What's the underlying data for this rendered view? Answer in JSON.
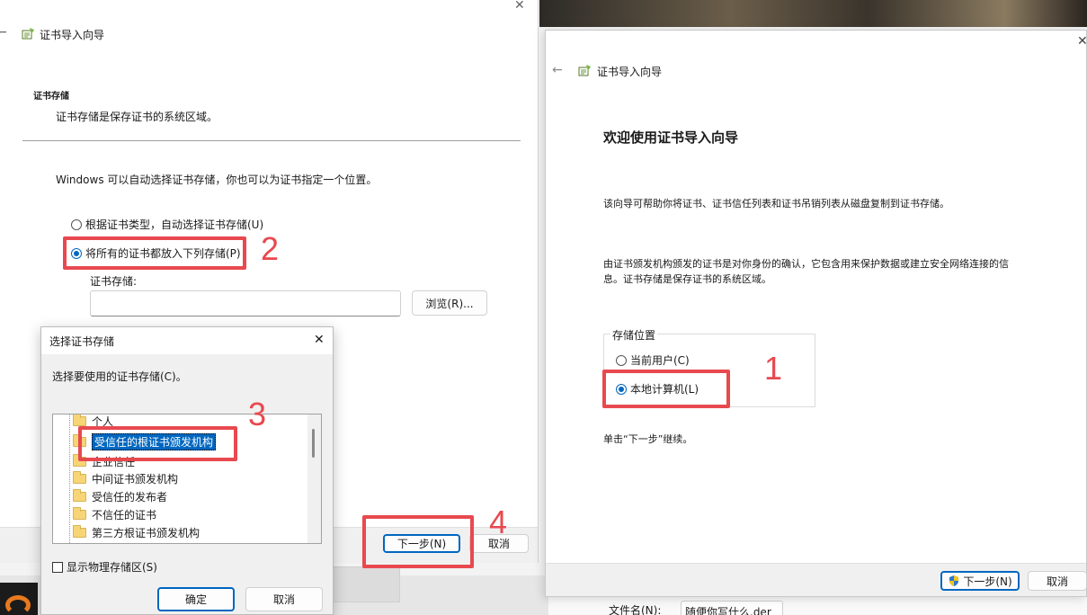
{
  "left_wizard": {
    "title": "证书导入向导",
    "section_title": "证书存储",
    "section_desc": "证书存储是保存证书的系统区域。",
    "intro": "Windows 可以自动选择证书存储，你也可以为证书指定一个位置。",
    "option_auto": "根据证书类型，自动选择证书存储(U)",
    "option_manual": "将所有的证书都放入下列存储(P)",
    "store_label": "证书存储:",
    "store_value": "",
    "browse_label": "浏览(R)...",
    "next_label": "下一步(N)",
    "cancel_label": "取消",
    "close_glyph": "✕",
    "back_glyph": "←"
  },
  "store_dialog": {
    "title": "选择证书存储",
    "instruction": "选择要使用的证书存储(C)。",
    "items": [
      {
        "label": "个人",
        "selected": false
      },
      {
        "label": "受信任的根证书颁发机构",
        "selected": true
      },
      {
        "label": "企业信任",
        "selected": false
      },
      {
        "label": "中间证书颁发机构",
        "selected": false
      },
      {
        "label": "受信任的发布者",
        "selected": false
      },
      {
        "label": "不信任的证书",
        "selected": false
      },
      {
        "label": "第三方根证书颁发机构",
        "selected": false
      }
    ],
    "show_physical_label": "显示物理存储区(S)",
    "ok_label": "确定",
    "cancel_label": "取消",
    "close_glyph": "✕"
  },
  "right_wizard": {
    "title": "证书导入向导",
    "heading": "欢迎使用证书导入向导",
    "para1": "该向导可帮助你将证书、证书信任列表和证书吊销列表从磁盘复制到证书存储。",
    "para2_line1": "由证书颁发机构颁发的证书是对你身份的确认，它包含用来保护数据或建立安全网络连接的信",
    "para2_line2": "息。证书存储是保存证书的系统区域。",
    "group_label": "存储位置",
    "option_current_user": "当前用户(C)",
    "option_local_machine": "本地计算机(L)",
    "continue_text": "单击“下一步”继续。",
    "next_label": "下一步(N)",
    "cancel_label": "取消",
    "close_glyph": "✕",
    "back_glyph": "←"
  },
  "file_panel": {
    "filename_label": "文件名(N):",
    "filename_value": "随便你写什么.der"
  },
  "annotations": {
    "step1": "1",
    "step2": "2",
    "step3": "3",
    "step4": "4",
    "color": "#e8494f"
  },
  "colors": {
    "accent": "#0067c0",
    "highlight_red": "#e8494f"
  }
}
